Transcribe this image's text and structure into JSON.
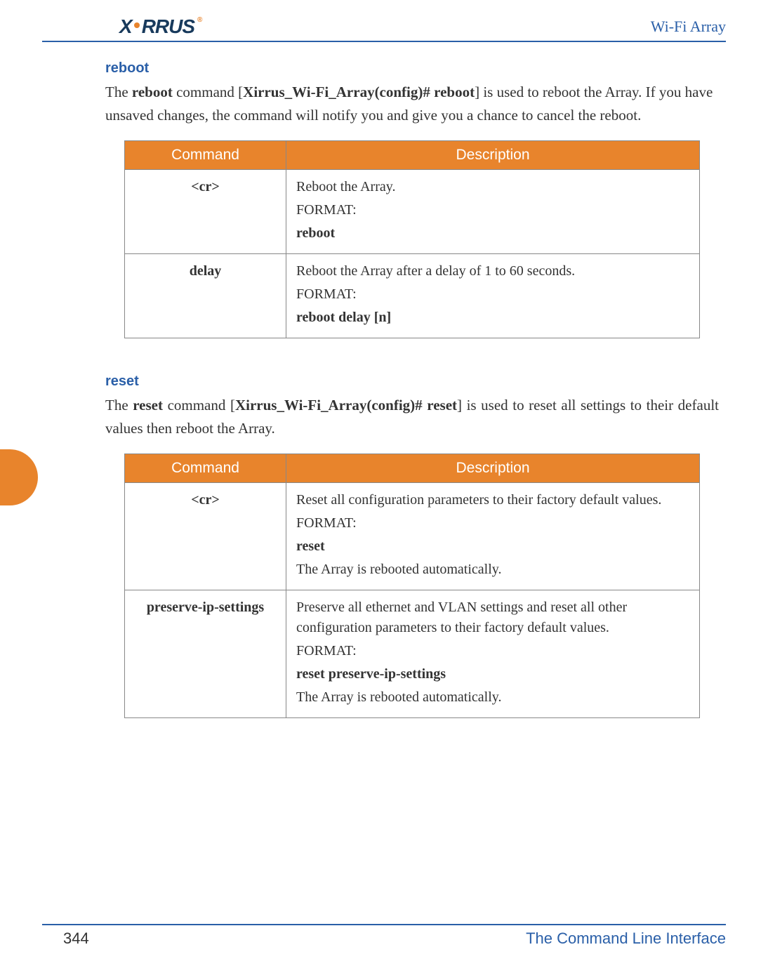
{
  "header": {
    "logo_text_1": "X",
    "logo_text_2": "RRUS",
    "logo_reg": "®",
    "right": "Wi-Fi Array"
  },
  "section1": {
    "title": "reboot",
    "intro_pre": "The ",
    "intro_cmd": "reboot",
    "intro_mid": " command [",
    "intro_prompt": "Xirrus_Wi-Fi_Array(config)# reboot",
    "intro_post": "] is used to reboot the Array. If you have unsaved changes, the command will notify you and give you a chance to cancel the reboot.",
    "table": {
      "h1": "Command",
      "h2": "Description",
      "rows": [
        {
          "cmd": "<cr>",
          "lines": [
            "Reboot the Array.",
            "FORMAT:"
          ],
          "bold_line": "reboot"
        },
        {
          "cmd": "delay",
          "lines": [
            "Reboot the Array after a delay of 1 to 60 seconds.",
            "FORMAT:"
          ],
          "bold_line": "reboot delay [n]"
        }
      ]
    }
  },
  "section2": {
    "title": "reset",
    "intro_pre": "The ",
    "intro_cmd": "reset",
    "intro_mid": " command [",
    "intro_prompt": "Xirrus_Wi-Fi_Array(config)# reset",
    "intro_post": "] is used to reset all settings to their default values then reboot the Array.",
    "table": {
      "h1": "Command",
      "h2": "Description",
      "rows": [
        {
          "cmd": "<cr>",
          "lines": [
            "Reset all configuration parameters to their factory default values.",
            "FORMAT:"
          ],
          "bold_line": "reset",
          "after": [
            "The Array is rebooted automatically."
          ]
        },
        {
          "cmd": "preserve-ip-settings",
          "lines": [
            "Preserve all ethernet and VLAN settings and reset all other configuration parameters to their factory default values.",
            "FORMAT:"
          ],
          "bold_line": "reset preserve-ip-settings",
          "after": [
            "The Array is rebooted automatically."
          ]
        }
      ]
    }
  },
  "footer": {
    "page": "344",
    "title": "The Command Line Interface"
  }
}
